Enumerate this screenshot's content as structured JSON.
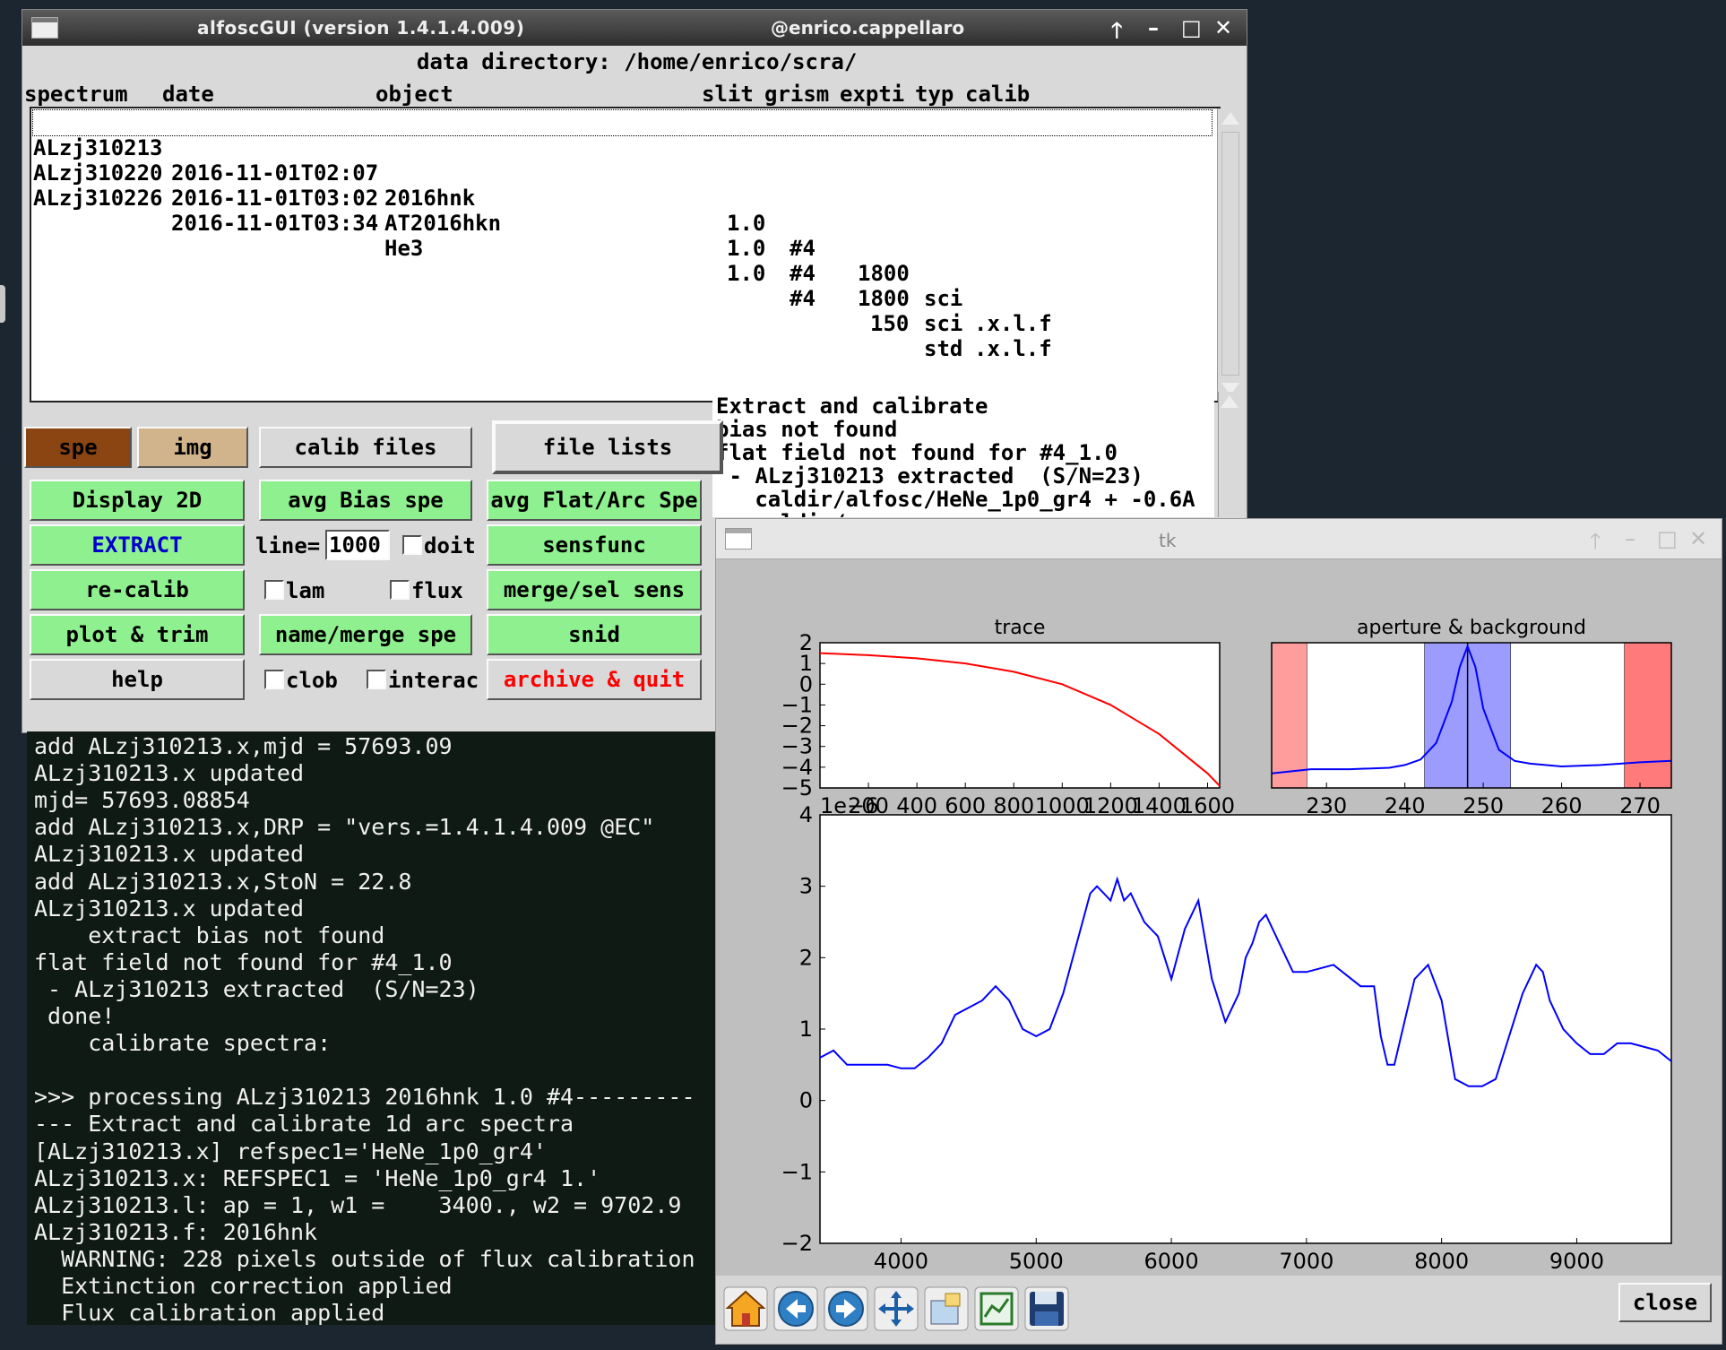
{
  "main_window": {
    "title": "alfoscGUI (version 1.4.1.4.009)",
    "user": "@enrico.cappellaro",
    "controls": {
      "up": "🡑",
      "minimize": "–",
      "maximize": "□",
      "close": "✕"
    },
    "data_directory": "data directory: /home/enrico/scra/",
    "headers": {
      "spectrum": "spectrum",
      "date": "date",
      "object": "object",
      "slit": "slit",
      "grism": "grism",
      "expti": "expti",
      "typ": "typ",
      "calib": "calib"
    },
    "files": [
      {
        "spectrum": "ALzj310213",
        "date": "2016-11-01T02:07",
        "object": "2016hnk",
        "slit": "1.0",
        "grism": "#4",
        "expti": "1800",
        "typ": "sci",
        "calib": ".x.l.f"
      },
      {
        "spectrum": "ALzj310220",
        "date": "2016-11-01T03:02",
        "object": "AT2016hkn",
        "slit": "1.0",
        "grism": "#4",
        "expti": "1800",
        "typ": "sci",
        "calib": ".x.l.f"
      },
      {
        "spectrum": "ALzj310226",
        "date": "2016-11-01T03:34",
        "object": "He3",
        "slit": "1.0",
        "grism": "#4",
        "expti": "150",
        "typ": "std",
        "calib": ""
      }
    ],
    "log": [
      "Extract and calibrate",
      "bias not found",
      "flat field not found for #4_1.0",
      " - ALzj310213 extracted  (S/N=23)",
      "   caldir/alfosc/HeNe_1p0_gr4 + -0.6A",
      "   caldir/..."
    ],
    "buttons": {
      "spe": "spe",
      "img": "img",
      "calib_files": "calib files",
      "file_lists": "file lists",
      "display_2d": "Display 2D",
      "avg_bias": "avg Bias spe",
      "avg_flat": "avg Flat/Arc Spe",
      "extract": "EXTRACT",
      "sensfunc": "sensfunc",
      "recalib": "re-calib",
      "merge_sel": "merge/sel sens",
      "plot_trim": "plot & trim",
      "name_merge": "name/merge spe",
      "snid": "snid",
      "help": "help",
      "archive_quit": "archive & quit"
    },
    "line_label": "line=",
    "line_value": "1000",
    "checkboxes": {
      "doit": "doit",
      "lam": "lam",
      "flux": "flux",
      "clob": "clob",
      "interac": "interac"
    },
    "colors": {
      "spe_active": "#8a4513",
      "img": "#d2b48c",
      "green_button": "#8ef08e",
      "extract_text": "#0000cc",
      "quit_text": "#ff0000"
    }
  },
  "terminal": {
    "lines": [
      "add ALzj310213.x,mjd = 57693.09",
      "ALzj310213.x updated",
      "mjd= 57693.08854",
      "add ALzj310213.x,DRP = \"vers.=1.4.1.4.009 @EC\"",
      "ALzj310213.x updated",
      "add ALzj310213.x,StoN = 22.8",
      "ALzj310213.x updated",
      "    extract bias not found",
      "flat field not found for #4_1.0",
      " - ALzj310213 extracted  (S/N=23)",
      " done!",
      "    calibrate spectra:",
      "",
      ">>> processing ALzj310213 2016hnk 1.0 #4---------",
      "--- Extract and calibrate 1d arc spectra",
      "[ALzj310213.x] refspec1='HeNe_1p0_gr4'",
      "ALzj310213.x: REFSPEC1 = 'HeNe_1p0_gr4 1.'",
      "ALzj310213.l: ap = 1, w1 =    3400., w2 = 9702.9",
      "ALzj310213.f: 2016hnk",
      "  WARNING: 228 pixels outside of flux calibration",
      "  Extinction correction applied",
      "  Flux calibration applied"
    ]
  },
  "tk_window": {
    "title": "tk",
    "controls": {
      "up": "🡑",
      "minimize": "–",
      "maximize": "□",
      "close": "✕"
    },
    "close_label": "close",
    "toolbar": [
      "home-icon",
      "back-arrow-icon",
      "forward-arrow-icon",
      "pan-icon",
      "zoom-icon",
      "subplots-icon",
      "save-icon"
    ]
  },
  "chart_data": [
    {
      "type": "line",
      "title": "trace",
      "x_range": [
        0,
        1650
      ],
      "y_range": [
        -5,
        2
      ],
      "xticks": [
        "200",
        "400",
        "600",
        "800",
        "1000",
        "1200",
        "1400",
        "1600"
      ],
      "yticks": [
        "2",
        "1",
        "0",
        "−1",
        "−2",
        "−3",
        "−4",
        "−5"
      ],
      "offset_label": "1e−6",
      "series": [
        {
          "color": "#ff0000",
          "x": [
            0,
            200,
            400,
            600,
            800,
            1000,
            1200,
            1400,
            1600,
            1650
          ],
          "y": [
            1.5,
            1.4,
            1.25,
            1.0,
            0.6,
            0.0,
            -1.0,
            -2.4,
            -4.3,
            -4.9
          ]
        }
      ]
    },
    {
      "type": "line",
      "title": "aperture & background",
      "x_range": [
        223,
        274
      ],
      "xticks": [
        "230",
        "240",
        "250",
        "260",
        "270"
      ],
      "bands": [
        {
          "from": 223,
          "to": 227.5,
          "color": "#ff9c9c"
        },
        {
          "from": 242.5,
          "to": 253.5,
          "color": "#9c9cff"
        },
        {
          "from": 268,
          "to": 274,
          "color": "#ff7b7b"
        }
      ],
      "center_line": 248,
      "series": [
        {
          "color": "#0000ff",
          "x": [
            223,
            228,
            233,
            238,
            240,
            242,
            244,
            246,
            247,
            248,
            249,
            250,
            252,
            254,
            256,
            260,
            265,
            270,
            274
          ],
          "y": [
            0.08,
            0.11,
            0.11,
            0.12,
            0.14,
            0.18,
            0.3,
            0.6,
            0.85,
            1.0,
            0.85,
            0.55,
            0.25,
            0.17,
            0.15,
            0.13,
            0.14,
            0.16,
            0.17
          ]
        }
      ]
    },
    {
      "type": "line",
      "x_range": [
        3400,
        9700
      ],
      "y_range": [
        -2,
        4
      ],
      "xticks": [
        "4000",
        "5000",
        "6000",
        "7000",
        "8000",
        "9000"
      ],
      "yticks": [
        "4",
        "3",
        "2",
        "1",
        "0",
        "−1",
        "−2"
      ],
      "series": [
        {
          "color": "#0000ff",
          "x": [
            3400,
            3500,
            3600,
            3700,
            3800,
            3900,
            4000,
            4100,
            4200,
            4300,
            4400,
            4500,
            4600,
            4700,
            4750,
            4800,
            4900,
            5000,
            5100,
            5200,
            5300,
            5400,
            5450,
            5500,
            5550,
            5600,
            5650,
            5700,
            5800,
            5850,
            5900,
            6000,
            6100,
            6200,
            6300,
            6400,
            6500,
            6550,
            6600,
            6650,
            6700,
            6800,
            6900,
            7000,
            7200,
            7400,
            7500,
            7550,
            7600,
            7650,
            7700,
            7800,
            7850,
            7900,
            8000,
            8100,
            8200,
            8300,
            8400,
            8500,
            8600,
            8700,
            8750,
            8800,
            8900,
            9000,
            9100,
            9200,
            9300,
            9400,
            9500,
            9600,
            9700
          ],
          "y": [
            0.6,
            0.7,
            0.5,
            0.5,
            0.5,
            0.5,
            0.45,
            0.45,
            0.6,
            0.8,
            1.2,
            1.3,
            1.4,
            1.6,
            1.5,
            1.4,
            1.0,
            0.9,
            1.0,
            1.5,
            2.2,
            2.9,
            3.0,
            2.9,
            2.8,
            3.1,
            2.8,
            2.9,
            2.5,
            2.4,
            2.3,
            1.7,
            2.4,
            2.8,
            1.7,
            1.1,
            1.5,
            2.0,
            2.2,
            2.5,
            2.6,
            2.2,
            1.8,
            1.8,
            1.9,
            1.6,
            1.6,
            0.9,
            0.5,
            0.5,
            0.9,
            1.7,
            1.8,
            1.9,
            1.4,
            0.3,
            0.2,
            0.2,
            0.3,
            0.9,
            1.5,
            1.9,
            1.8,
            1.4,
            1.0,
            0.8,
            0.65,
            0.65,
            0.8,
            0.8,
            0.75,
            0.7,
            0.55
          ]
        }
      ]
    }
  ]
}
